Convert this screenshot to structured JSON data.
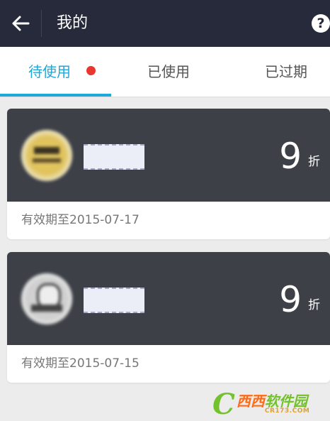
{
  "header": {
    "back_icon": "arrow-left-icon",
    "title": "我的",
    "help_label": "?"
  },
  "tabs": [
    {
      "label": "待使用",
      "active": true,
      "has_notification_dot": true
    },
    {
      "label": "已使用",
      "active": false
    },
    {
      "label": "已过期",
      "active": false
    }
  ],
  "coupons": [
    {
      "discount": "9",
      "unit": "折",
      "expiry": "有效期至2015-07-17"
    },
    {
      "discount": "9",
      "unit": "折",
      "expiry": "有效期至2015-07-15"
    }
  ],
  "watermark": {
    "letter": "C",
    "text_part1": "西西",
    "text_part2": "软件园",
    "sub": "CR173.COM"
  },
  "colors": {
    "header_bg": "#262a3b",
    "accent": "#1fa8d8",
    "notification_dot": "#e9372f",
    "card_top": "#3d4047"
  }
}
